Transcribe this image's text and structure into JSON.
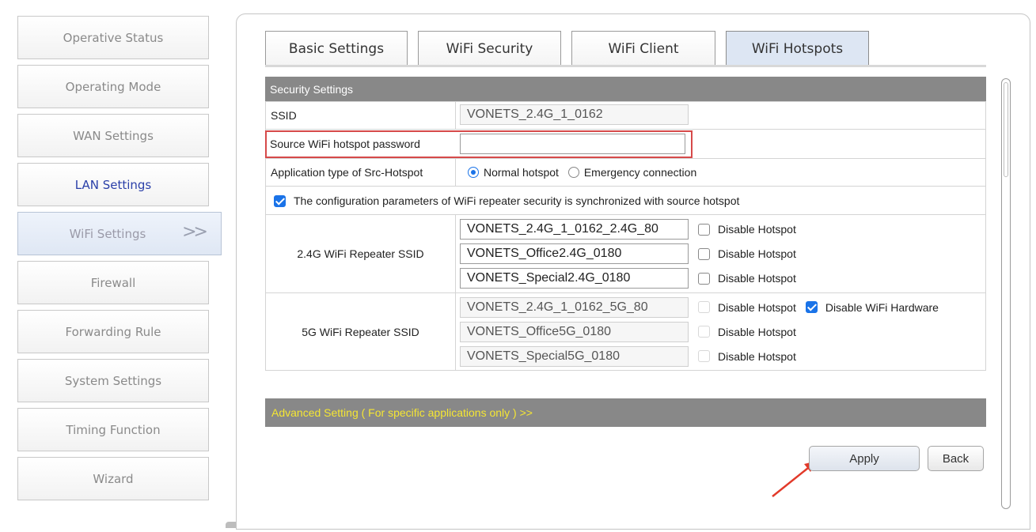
{
  "sidebar": {
    "items": [
      {
        "label": "Operative Status"
      },
      {
        "label": "Operating Mode"
      },
      {
        "label": "WAN Settings"
      },
      {
        "label": "LAN Settings"
      },
      {
        "label": "WiFi Settings",
        "chevron": ">>"
      },
      {
        "label": "Firewall"
      },
      {
        "label": "Forwarding Rule"
      },
      {
        "label": "System Settings"
      },
      {
        "label": "Timing Function"
      },
      {
        "label": "Wizard"
      }
    ]
  },
  "tabs": [
    {
      "label": "Basic Settings"
    },
    {
      "label": "WiFi Security"
    },
    {
      "label": "WiFi Client"
    },
    {
      "label": "WiFi Hotspots",
      "active": true
    }
  ],
  "form": {
    "section_title": "Security Settings",
    "ssid_label": "SSID",
    "ssid_value": "VONETS_2.4G_1_0162",
    "password_label": "Source WiFi hotspot password",
    "password_value": "",
    "app_type_label": "Application type of Src-Hotspot",
    "app_type_options": [
      "Normal hotspot",
      "Emergency connection"
    ],
    "app_type_selected": "Normal hotspot",
    "sync_label": "The configuration parameters of WiFi repeater security is synchronized with source hotspot",
    "sync_checked": true,
    "repeater_24_label": "2.4G WiFi Repeater SSID",
    "repeater_24": [
      {
        "ssid": "VONETS_2.4G_1_0162_2.4G_80",
        "disable_label": "Disable Hotspot"
      },
      {
        "ssid": "VONETS_Office2.4G_0180",
        "disable_label": "Disable Hotspot"
      },
      {
        "ssid": "VONETS_Special2.4G_0180",
        "disable_label": "Disable Hotspot"
      }
    ],
    "repeater_5_label": "5G WiFi Repeater SSID",
    "repeater_5": [
      {
        "ssid": "VONETS_2.4G_1_0162_5G_80",
        "disable_label": "Disable Hotspot"
      },
      {
        "ssid": "VONETS_Office5G_0180",
        "disable_label": "Disable Hotspot"
      },
      {
        "ssid": "VONETS_Special5G_0180",
        "disable_label": "Disable Hotspot"
      }
    ],
    "disable_hardware_label": "Disable WiFi Hardware",
    "disable_hardware_checked": true
  },
  "advanced": {
    "label": "Advanced Setting ( For specific applications only ) >>"
  },
  "buttons": {
    "apply": "Apply",
    "back": "Back"
  },
  "colors": {
    "header_gray": "#888888",
    "advanced_text": "#f5e633",
    "accent_blue": "#1a73e8",
    "highlight_red": "#d64a4a",
    "arrow_red": "#e23a2a"
  }
}
